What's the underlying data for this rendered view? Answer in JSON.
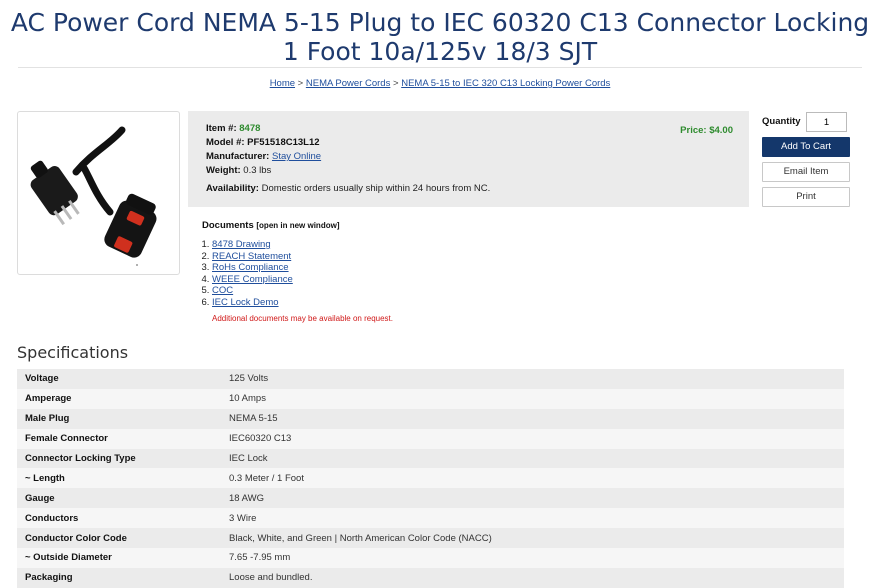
{
  "product": {
    "title": "AC Power Cord NEMA 5-15 Plug to IEC 60320 C13 Connector Locking 1 Foot 10a/125v 18/3 SJT"
  },
  "breadcrumb": {
    "items": [
      "Home",
      "NEMA Power Cords",
      "NEMA 5-15 to IEC 320 C13 Locking Power Cords"
    ],
    "separator": ">"
  },
  "details": {
    "item_label": "Item #:",
    "item_value": "8478",
    "model_label": "Model #:",
    "model_value": "PF51518C13L12",
    "manufacturer_label": "Manufacturer:",
    "manufacturer_value": "Stay Online",
    "weight_label": "Weight:",
    "weight_value": "0.3 lbs",
    "availability_label": "Availability:",
    "availability_value": "Domestic orders usually ship within 24 hours from NC.",
    "price_label": "Price:",
    "price_value": "$4.00"
  },
  "cart": {
    "quantity_label": "Quantity",
    "quantity_value": "1",
    "add_to_cart_label": "Add To Cart",
    "email_label": "Email Item",
    "print_label": "Print"
  },
  "documents": {
    "heading": "Documents",
    "heading_note": "[open in new window]",
    "items": [
      "8478 Drawing",
      "REACH Statement",
      "RoHs Compliance",
      "WEEE Compliance",
      "COC",
      "IEC Lock Demo"
    ],
    "note": "Additional documents may be available on request."
  },
  "specifications": {
    "heading": "Specifications",
    "rows": [
      {
        "key": "Voltage",
        "value": "125 Volts"
      },
      {
        "key": "Amperage",
        "value": "10 Amps"
      },
      {
        "key": "Male Plug",
        "value": "NEMA 5-15"
      },
      {
        "key": "Female Connector",
        "value": "IEC60320 C13"
      },
      {
        "key": "Connector Locking Type",
        "value": "IEC Lock"
      },
      {
        "key": "~ Length",
        "value": "0.3 Meter / 1 Foot"
      },
      {
        "key": "Gauge",
        "value": "18 AWG"
      },
      {
        "key": "Conductors",
        "value": "3 Wire"
      },
      {
        "key": "Conductor Color Code",
        "value": "Black, White, and Green | North American Color Code (NACC)"
      },
      {
        "key": "~ Outside Diameter",
        "value": "7.65 -7.95 mm"
      },
      {
        "key": "Packaging",
        "value": "Loose and bundled."
      }
    ]
  },
  "colors": {
    "title": "#1e3a6e",
    "link": "#1f4e9c",
    "price_green": "#2e8b2e",
    "primary_button": "#14376b",
    "note_red": "#d01818"
  }
}
